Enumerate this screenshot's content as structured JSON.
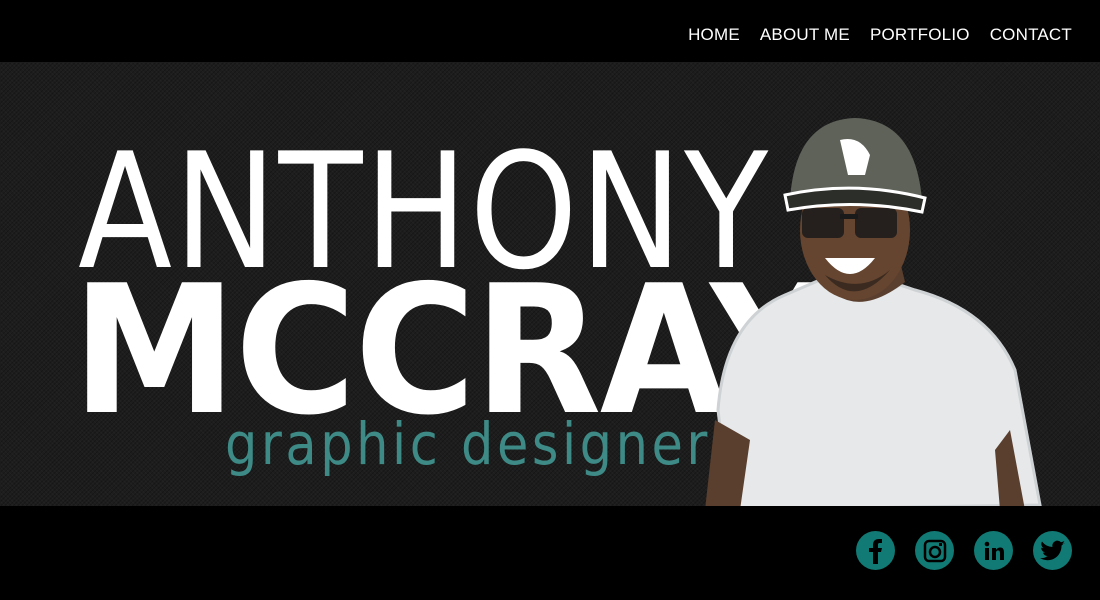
{
  "nav": {
    "items": [
      {
        "label": "HOME"
      },
      {
        "label": "ABOUT ME"
      },
      {
        "label": "PORTFOLIO"
      },
      {
        "label": "CONTACT"
      }
    ]
  },
  "hero": {
    "first_name": "ANTHONY",
    "last_name": "MCCRAY",
    "role": "graphic designer"
  },
  "social": [
    {
      "icon": "facebook-icon"
    },
    {
      "icon": "instagram-icon"
    },
    {
      "icon": "linkedin-icon"
    },
    {
      "icon": "twitter-icon"
    }
  ],
  "colors": {
    "accent": "#127a74",
    "role_text": "#3d8a86",
    "bar": "#000000",
    "hero_bg": "#1d1d1d"
  }
}
